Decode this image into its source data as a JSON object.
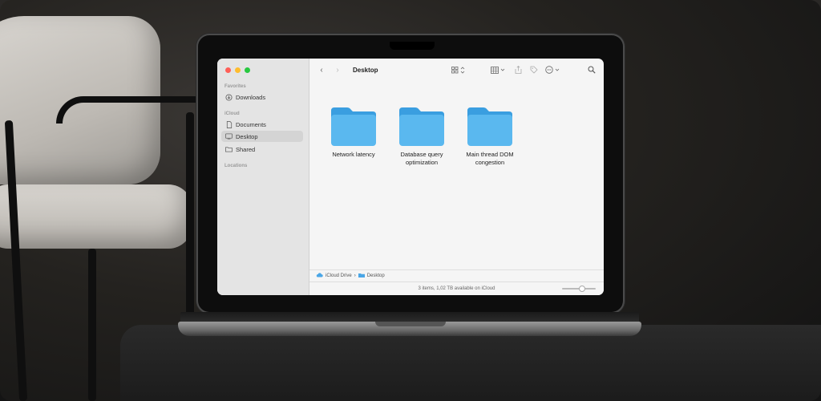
{
  "window": {
    "title": "Desktop"
  },
  "sidebar": {
    "sections": [
      {
        "title": "Favorites",
        "items": [
          {
            "label": "Downloads",
            "icon": "download-icon"
          }
        ]
      },
      {
        "title": "iCloud",
        "items": [
          {
            "label": "Documents",
            "icon": "document-icon"
          },
          {
            "label": "Desktop",
            "icon": "desktop-icon",
            "active": true
          },
          {
            "label": "Shared",
            "icon": "shared-folder-icon"
          }
        ]
      },
      {
        "title": "Locations",
        "items": []
      }
    ]
  },
  "folders": [
    {
      "label": "Network latency"
    },
    {
      "label": "Database query optimization"
    },
    {
      "label": "Main thread DOM congestion"
    }
  ],
  "pathbar": {
    "root": "iCloud Drive",
    "separator": "›",
    "current": "Desktop"
  },
  "status": {
    "text": "3 items, 1,02 TB available on iCloud",
    "zoom_level": 0.6
  },
  "colors": {
    "folder": "#5ab8ef",
    "folder_tab": "#3a9ee0",
    "close": "#ff5f57",
    "minimize": "#febc2e",
    "zoom": "#28c840"
  }
}
